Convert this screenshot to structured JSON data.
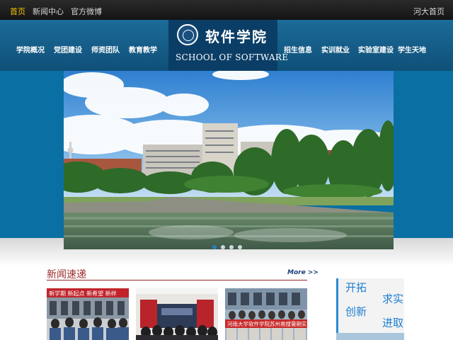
{
  "topbar": {
    "links": [
      "首页",
      "新闻中心",
      "官方微博"
    ],
    "right_link": "河大首页"
  },
  "nav": {
    "left_items": [
      "学院概况",
      "党团建设",
      "师资团队",
      "教育教学"
    ],
    "right_items": [
      "招生信息",
      "实训就业",
      "实验室建设",
      "学生天地"
    ]
  },
  "logo": {
    "name_cn": "软件学院",
    "name_en": "SCHOOL OF SOFTWARE"
  },
  "banner": {
    "slide_count": 4,
    "active_slide": 1
  },
  "news": {
    "title": "新闻速递",
    "more_label": "More >>",
    "thumb1_banner": "新学期 新起点 新希望 新样",
    "thumb3_banner": "河南大学软件学院苏州易搜暑期实习会"
  },
  "side": {
    "slogan_1": "开拓",
    "slogan_2": "求实",
    "slogan_3": "创新",
    "slogan_4": "进取"
  },
  "colors": {
    "topbar": "#1e1e1e",
    "active_link": "#f5c400",
    "nav": "#15608d",
    "logo_box": "#0b3e66",
    "news_title": "#9a2a2a",
    "slogan": "#1d7fd1"
  }
}
